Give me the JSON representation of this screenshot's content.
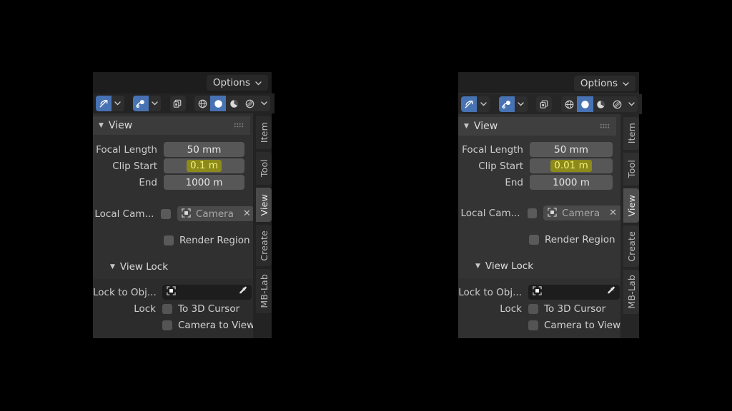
{
  "app": {
    "name": "Blender 3D Viewport Sidebar",
    "background_color": "#000000"
  },
  "panels": [
    {
      "id": "left",
      "clip_start_value": "0.1 m",
      "header": {
        "options_label": "Options",
        "options_caret": "chevron-down-icon"
      },
      "toolbar": {
        "transform_orientation_icon": "transform-orientation-icon",
        "snap_icon": "snap-magnet-icon",
        "proportional_edit_icon": "proportional-editing-icon",
        "shading_wireframe_icon": "wireframe-sphere-icon",
        "shading_solid_icon": "solid-sphere-icon",
        "shading_material_icon": "material-preview-sphere-icon",
        "shading_rendered_icon": "rendered-sphere-icon",
        "overflow_caret": "chevron-down-icon"
      },
      "section": {
        "title": "View",
        "collapse_icon": "triangle-down-icon",
        "grip": "drag-grip-dots"
      },
      "fields": [
        {
          "label": "Focal Length",
          "value": "50 mm",
          "highlighted": false
        },
        {
          "label": "Clip Start",
          "value": "0.1 m",
          "highlighted": true
        },
        {
          "label": "End",
          "value": "1000 m",
          "highlighted": false
        }
      ],
      "local_camera": {
        "label": "Local Cam...",
        "checkbox_checked": false,
        "object_name": "Camera",
        "object_icon": "camera-object-icon",
        "clear_icon": "x-close-icon"
      },
      "render_region": {
        "label": "Render Region",
        "checked": false
      },
      "view_lock": {
        "title": "View Lock",
        "collapse_icon": "triangle-down-icon"
      },
      "lock_to_object": {
        "label": "Lock to Obj...",
        "value": "",
        "object_icon": "object-pick-icon",
        "eyedropper_icon": "eyedropper-icon"
      },
      "lock": {
        "label": "Lock",
        "items": [
          {
            "label": "To 3D Cursor",
            "checked": false
          },
          {
            "label": "Camera to View",
            "checked": false
          }
        ]
      },
      "tabs": [
        {
          "label": "Item",
          "active": false
        },
        {
          "label": "Tool",
          "active": false
        },
        {
          "label": "View",
          "active": true
        },
        {
          "label": "Create",
          "active": false
        },
        {
          "label": "MB-Lab",
          "active": false
        }
      ]
    },
    {
      "id": "right",
      "clip_start_value": "0.01 m",
      "header": {
        "options_label": "Options",
        "options_caret": "chevron-down-icon"
      },
      "toolbar": {
        "transform_orientation_icon": "transform-orientation-icon",
        "snap_icon": "snap-magnet-icon",
        "proportional_edit_icon": "proportional-editing-icon",
        "shading_wireframe_icon": "wireframe-sphere-icon",
        "shading_solid_icon": "solid-sphere-icon",
        "shading_material_icon": "material-preview-sphere-icon",
        "shading_rendered_icon": "rendered-sphere-icon",
        "overflow_caret": "chevron-down-icon"
      },
      "section": {
        "title": "View",
        "collapse_icon": "triangle-down-icon",
        "grip": "drag-grip-dots"
      },
      "fields": [
        {
          "label": "Focal Length",
          "value": "50 mm",
          "highlighted": false
        },
        {
          "label": "Clip Start",
          "value": "0.01 m",
          "highlighted": true
        },
        {
          "label": "End",
          "value": "1000 m",
          "highlighted": false
        }
      ],
      "local_camera": {
        "label": "Local Cam...",
        "checkbox_checked": false,
        "object_name": "Camera",
        "object_icon": "camera-object-icon",
        "clear_icon": "x-close-icon"
      },
      "render_region": {
        "label": "Render Region",
        "checked": false
      },
      "view_lock": {
        "title": "View Lock",
        "collapse_icon": "triangle-down-icon"
      },
      "lock_to_object": {
        "label": "Lock to Obj...",
        "value": "",
        "object_icon": "object-pick-icon",
        "eyedropper_icon": "eyedropper-icon"
      },
      "lock": {
        "label": "Lock",
        "items": [
          {
            "label": "To 3D Cursor",
            "checked": false
          },
          {
            "label": "Camera to View",
            "checked": false
          }
        ]
      },
      "tabs": [
        {
          "label": "Item",
          "active": false
        },
        {
          "label": "Tool",
          "active": false
        },
        {
          "label": "View",
          "active": true
        },
        {
          "label": "Create",
          "active": false
        },
        {
          "label": "MB-Lab",
          "active": false
        }
      ]
    }
  ],
  "colors": {
    "panel_bg": "#303030",
    "header_bg": "#1d1d1d",
    "section_bg": "#3b3b3b",
    "field_bg": "#575757",
    "accent_blue": "#4772b3",
    "selection_yellow": "#8c8a1a",
    "selection_text": "#f2f07a"
  }
}
